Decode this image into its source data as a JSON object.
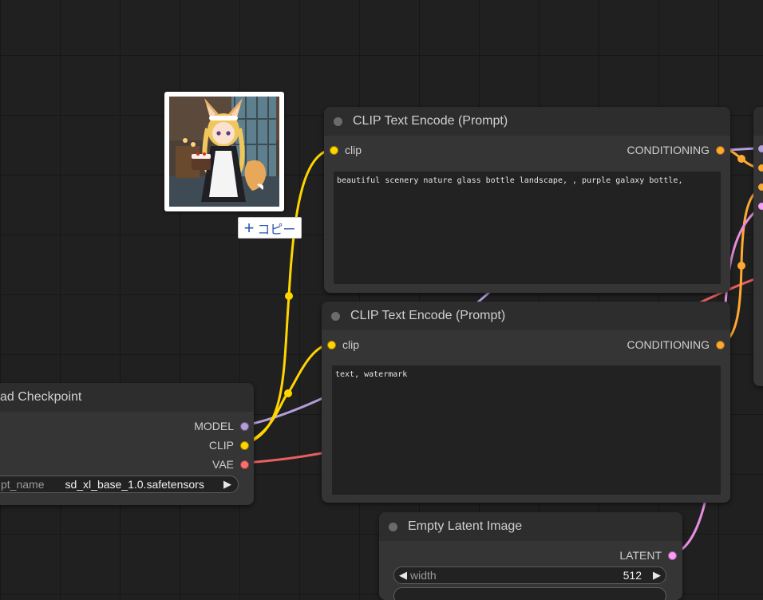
{
  "colors": {
    "clip": "#ffd500",
    "model": "#b39ddb",
    "vae": "#ff6e6e",
    "conditioning": "#ffa931",
    "latent": "#ff9cf9"
  },
  "checkpoint_node": {
    "title": "ad Checkpoint",
    "outputs": {
      "model": "MODEL",
      "clip": "CLIP",
      "vae": "VAE"
    },
    "widget_label": "pt_name",
    "widget_value": "sd_xl_base_1.0.safetensors"
  },
  "clip_node_positive": {
    "title": "CLIP Text Encode (Prompt)",
    "input": "clip",
    "output": "CONDITIONING",
    "text": "beautiful scenery nature glass bottle landscape, , purple galaxy bottle,"
  },
  "clip_node_negative": {
    "title": "CLIP Text Encode (Prompt)",
    "input": "clip",
    "output": "CONDITIONING",
    "text": "text, watermark"
  },
  "latent_node": {
    "title": "Empty Latent Image",
    "output": "LATENT",
    "width_label": "width",
    "width_value": "512"
  },
  "copy_button": {
    "icon": "plus-icon",
    "label": "コピー"
  },
  "thumbnail": {
    "icon": "image-thumbnail"
  }
}
